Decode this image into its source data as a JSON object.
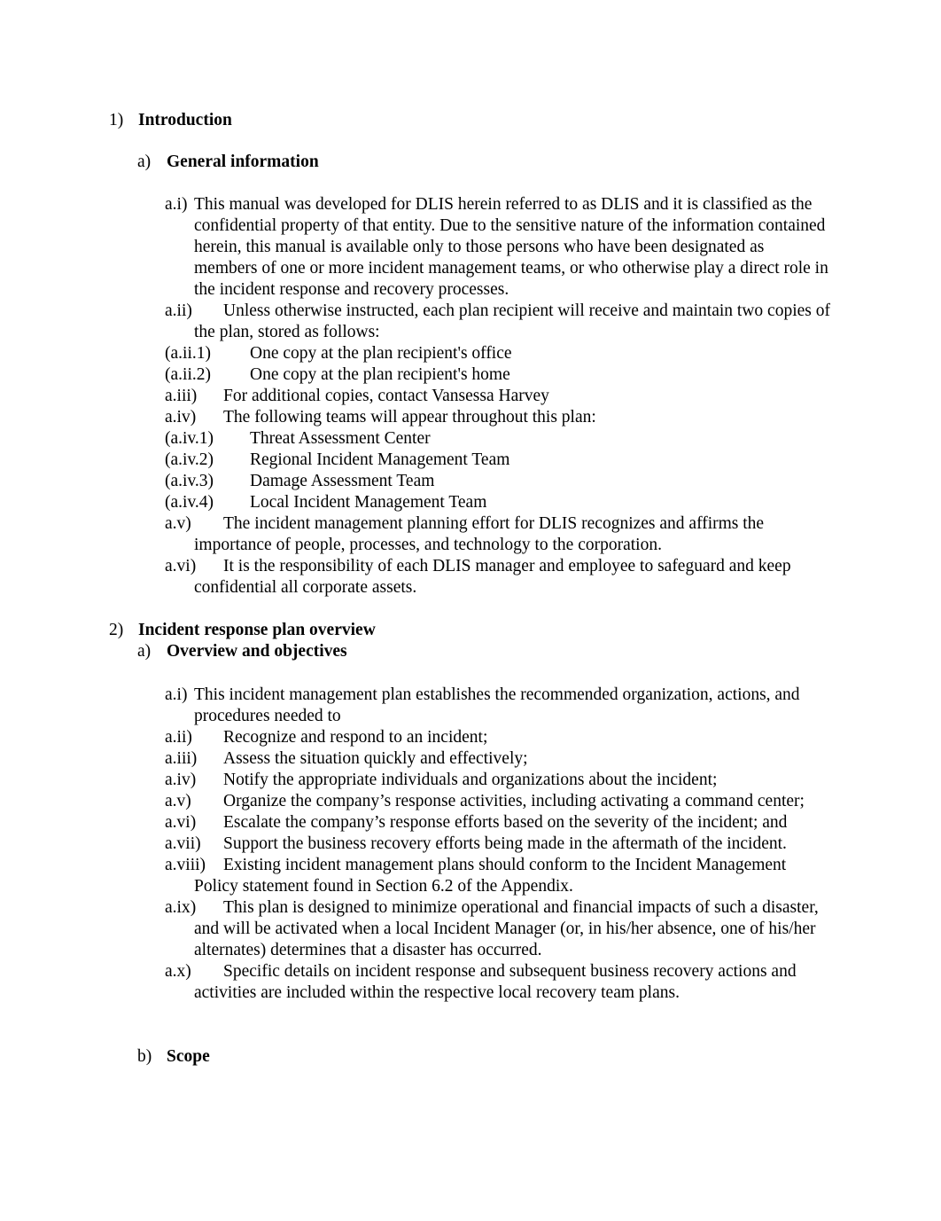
{
  "document": {
    "sections": [
      {
        "marker": "1)",
        "title": "Introduction",
        "subsections": [
          {
            "marker": "a)",
            "title": "General information",
            "items": [
              {
                "marker": "a.i)",
                "text": "This manual was developed for DLIS herein referred to as DLIS and it is classified as the confidential property of that entity. Due to the sensitive nature of the information contained herein, this manual is available only to those persons who have been designated as members of one or more incident management teams, or who otherwise play a direct role in the incident response and recovery processes."
              },
              {
                "marker": "a.ii)",
                "text": "Unless otherwise instructed, each plan recipient will receive and maintain two copies of the plan, stored as follows:",
                "children": [
                  {
                    "marker": "(a.ii.1)",
                    "text": "One copy at the plan recipient's office"
                  },
                  {
                    "marker": "(a.ii.2)",
                    "text": "One copy at the plan recipient's home"
                  }
                ]
              },
              {
                "marker": "a.iii)",
                "text": "For additional copies, contact Vansessa Harvey"
              },
              {
                "marker": "a.iv)",
                "text": "The following teams will appear throughout this plan:",
                "children": [
                  {
                    "marker": "(a.iv.1)",
                    "text": "Threat Assessment Center"
                  },
                  {
                    "marker": "(a.iv.2)",
                    "text": "Regional Incident Management Team"
                  },
                  {
                    "marker": "(a.iv.3)",
                    "text": "Damage Assessment Team"
                  },
                  {
                    "marker": "(a.iv.4)",
                    "text": "Local Incident Management Team"
                  }
                ]
              },
              {
                "marker": "a.v)",
                "text": "The incident management planning effort for DLIS recognizes and affirms the importance of people, processes, and technology to the corporation."
              },
              {
                "marker": "a.vi)",
                "text": "It is the responsibility of each DLIS manager and employee to safeguard and keep confidential all corporate assets."
              }
            ]
          }
        ]
      },
      {
        "marker": "2)",
        "title": "Incident response plan overview",
        "subsections": [
          {
            "marker": "a)",
            "title": "Overview and objectives",
            "items": [
              {
                "marker": "a.i)",
                "text": "This incident management plan establishes the recommended organization, actions, and procedures needed to"
              },
              {
                "marker": "a.ii)",
                "text": "Recognize and respond to an incident;"
              },
              {
                "marker": "a.iii)",
                "text": "Assess the situation quickly and effectively;"
              },
              {
                "marker": "a.iv)",
                "text": "Notify the appropriate individuals and organizations about the incident;"
              },
              {
                "marker": "a.v)",
                "text": "Organize the company’s response activities, including activating a command center;"
              },
              {
                "marker": "a.vi)",
                "text": "Escalate the company’s response efforts based on the severity of the incident; and"
              },
              {
                "marker": "a.vii)",
                "text": "Support the business recovery efforts being made in the aftermath of the incident."
              },
              {
                "marker": "a.viii)",
                "text": "Existing incident management plans should conform to the Incident Management Policy statement found in Section 6.2 of the Appendix."
              },
              {
                "marker": "a.ix)",
                "text": "This plan is designed to minimize operational and financial impacts of such a disaster, and will be activated when a local Incident Manager (or, in his/her absence, one of his/her alternates) determines that a disaster has occurred."
              },
              {
                "marker": "a.x)",
                "text": "Specific details on incident response and subsequent business recovery actions and activities are included within the respective local recovery team plans."
              }
            ]
          },
          {
            "marker": "b)",
            "title": "Scope",
            "items": []
          }
        ]
      }
    ]
  }
}
